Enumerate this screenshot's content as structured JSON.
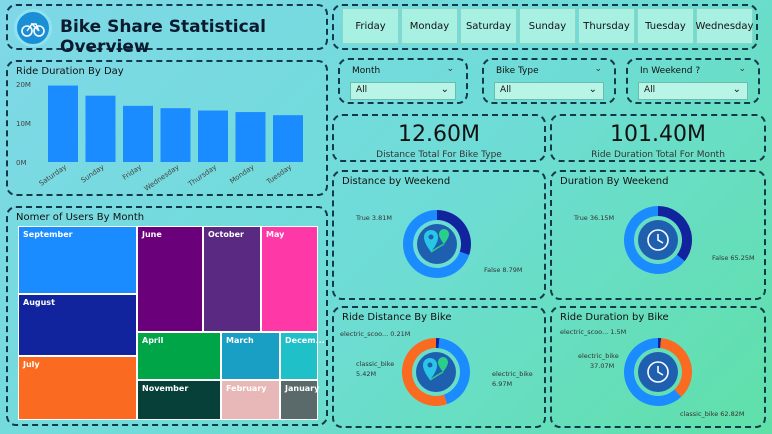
{
  "header": {
    "title": "Bike Share Statistical Overview",
    "logo_icon": "bicycle-icon"
  },
  "days": [
    "Friday",
    "Monday",
    "Saturday",
    "Sunday",
    "Thursday",
    "Tuesday",
    "Wednesday"
  ],
  "slicers": [
    {
      "label": "Month",
      "value": "All"
    },
    {
      "label": "Bike Type",
      "value": "All"
    },
    {
      "label": "In Weekend ?",
      "value": "All"
    }
  ],
  "kpis": [
    {
      "value": "12.60M",
      "label": "Distance Total For Bike Type"
    },
    {
      "value": "101.40M",
      "label": "Ride Duration Total For Month"
    }
  ],
  "bar_chart": {
    "title": "Ride Duration By Day",
    "ticks": [
      "20M",
      "10M",
      "0M"
    ],
    "chart_data": {
      "type": "bar",
      "categories": [
        "Saturday",
        "Sunday",
        "Friday",
        "Wednesday",
        "Thursday",
        "Monday",
        "Tuesday"
      ],
      "values": [
        19.6,
        17.0,
        14.4,
        13.8,
        13.2,
        12.8,
        12.0
      ],
      "ylim": [
        0,
        20
      ],
      "color": "#1a8cff"
    }
  },
  "treemap": {
    "title": "Nomer of Users By Month",
    "cells": [
      {
        "label": "September",
        "color": "#1a8cff"
      },
      {
        "label": "August",
        "color": "#12239e"
      },
      {
        "label": "July",
        "color": "#fa6a20"
      },
      {
        "label": "June",
        "color": "#6b007b"
      },
      {
        "label": "October",
        "color": "#5a2a82"
      },
      {
        "label": "May",
        "color": "#ff38a8"
      },
      {
        "label": "April",
        "color": "#00a548"
      },
      {
        "label": "March",
        "color": "#1a9fc4"
      },
      {
        "label": "Decem...",
        "color": "#20c0c8"
      },
      {
        "label": "November",
        "color": "#064038"
      },
      {
        "label": "February",
        "color": "#e8b8b8"
      },
      {
        "label": "January",
        "color": "#5a6a6a"
      }
    ]
  },
  "donuts": [
    {
      "title": "Distance by Weekend",
      "icon": "location-icon",
      "labels": [
        {
          "text": "True 3.81M"
        },
        {
          "text": "False 8.79M"
        }
      ],
      "chart_data": {
        "type": "pie",
        "categories": [
          "True",
          "False"
        ],
        "values": [
          3.81,
          8.79
        ],
        "colors": [
          "#12239e",
          "#1a8cff"
        ]
      }
    },
    {
      "title": "Duration By Weekend",
      "icon": "clock-icon",
      "labels": [
        {
          "text": "True 36.15M"
        },
        {
          "text": "False 65.25M"
        }
      ],
      "chart_data": {
        "type": "pie",
        "categories": [
          "True",
          "False"
        ],
        "values": [
          36.15,
          65.25
        ],
        "colors": [
          "#12239e",
          "#1a8cff"
        ]
      }
    },
    {
      "title": "Ride Distance By Bike",
      "icon": "location-icon",
      "labels": [
        {
          "text": "electric_scoo... 0.21M"
        },
        {
          "text": "classic_bike"
        },
        {
          "text": "5.42M"
        },
        {
          "text": "electric_bike"
        },
        {
          "text": "6.97M"
        }
      ],
      "chart_data": {
        "type": "pie",
        "categories": [
          "electric_scooter",
          "classic_bike",
          "electric_bike"
        ],
        "values": [
          0.21,
          5.42,
          6.97
        ],
        "colors": [
          "#12239e",
          "#1a8cff",
          "#fa6a20"
        ]
      }
    },
    {
      "title": "Ride Duration by Bike",
      "icon": "clock-icon",
      "labels": [
        {
          "text": "electric_scoo... 1.5M"
        },
        {
          "text": "electric_bike"
        },
        {
          "text": "37.07M"
        },
        {
          "text": "classic_bike 62.82M"
        }
      ],
      "chart_data": {
        "type": "pie",
        "categories": [
          "electric_scooter",
          "electric_bike",
          "classic_bike"
        ],
        "values": [
          1.5,
          37.07,
          62.82
        ],
        "colors": [
          "#12239e",
          "#fa6a20",
          "#1a8cff"
        ]
      }
    }
  ]
}
